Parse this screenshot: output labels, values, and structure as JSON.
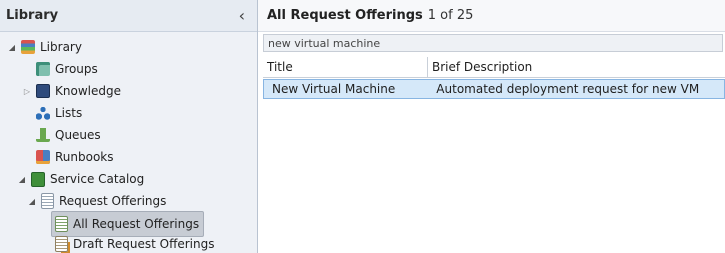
{
  "sidebar": {
    "title": "Library",
    "collapse_glyph": "‹",
    "items": [
      {
        "label": "Library",
        "icon": "library-icon",
        "expanded": true
      },
      {
        "label": "Groups",
        "icon": "groups-icon"
      },
      {
        "label": "Knowledge",
        "icon": "knowledge-icon",
        "expanded": false
      },
      {
        "label": "Lists",
        "icon": "lists-icon"
      },
      {
        "label": "Queues",
        "icon": "queues-icon"
      },
      {
        "label": "Runbooks",
        "icon": "runbooks-icon"
      },
      {
        "label": "Service Catalog",
        "icon": "service-catalog-icon",
        "expanded": true
      },
      {
        "label": "Request Offerings",
        "icon": "request-offerings-icon",
        "expanded": true
      },
      {
        "label": "All Request Offerings",
        "icon": "all-request-offerings-icon",
        "selected": true
      },
      {
        "label": "Draft Request Offerings",
        "icon": "draft-request-offerings-icon"
      }
    ]
  },
  "main": {
    "title": "All Request Offerings",
    "count": "1 of 25",
    "search_value": "new virtual machine",
    "columns": [
      "Title",
      "Brief Description"
    ],
    "rows": [
      {
        "title": "New Virtual Machine",
        "description": "Automated deployment request for new VM"
      }
    ]
  }
}
